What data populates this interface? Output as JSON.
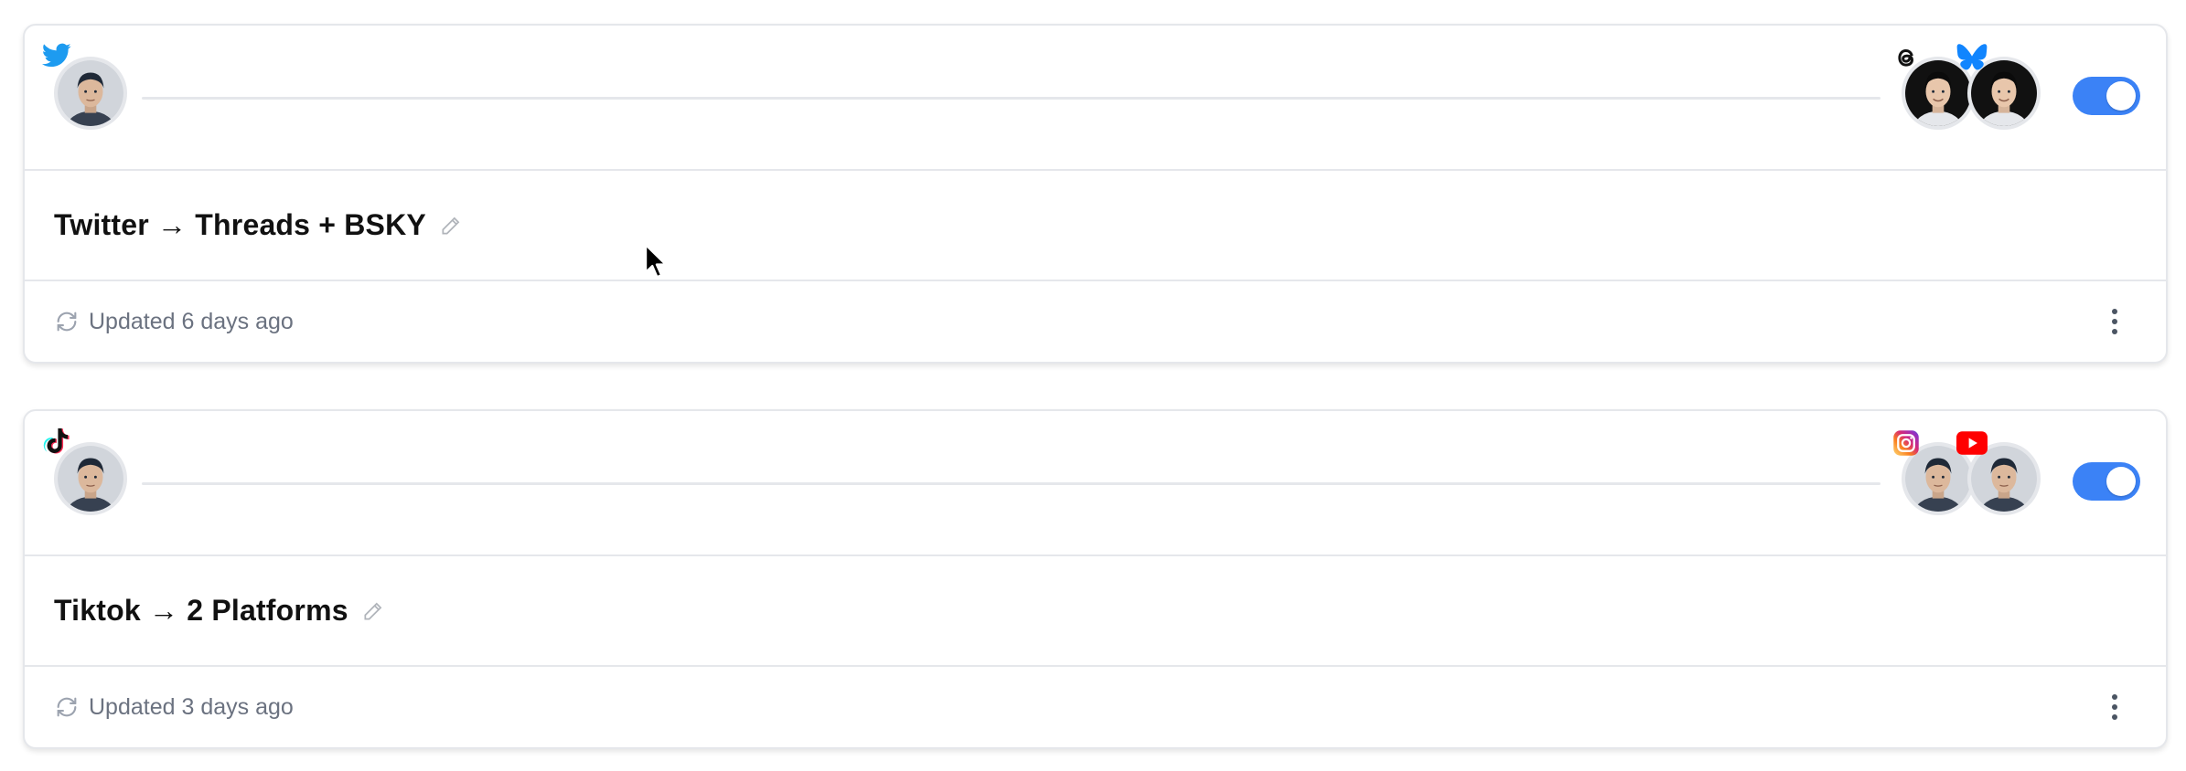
{
  "workflows": [
    {
      "source_icon": "twitter-icon",
      "destination_icons": [
        "threads-icon",
        "bluesky-icon"
      ],
      "title": "Twitter → Threads + BSKY",
      "updated": "Updated 6 days ago",
      "enabled": true
    },
    {
      "source_icon": "tiktok-icon",
      "destination_icons": [
        "instagram-icon",
        "youtube-icon"
      ],
      "title": "Tiktok → 2 Platforms",
      "updated": "Updated 3 days ago",
      "enabled": true
    }
  ],
  "colors": {
    "toggle_on": "#3b82f6",
    "border": "#e5e7eb",
    "muted_text": "#6b7280",
    "twitter": "#1d9bf0",
    "bluesky": "#1185fe",
    "youtube": "#ff0000"
  }
}
